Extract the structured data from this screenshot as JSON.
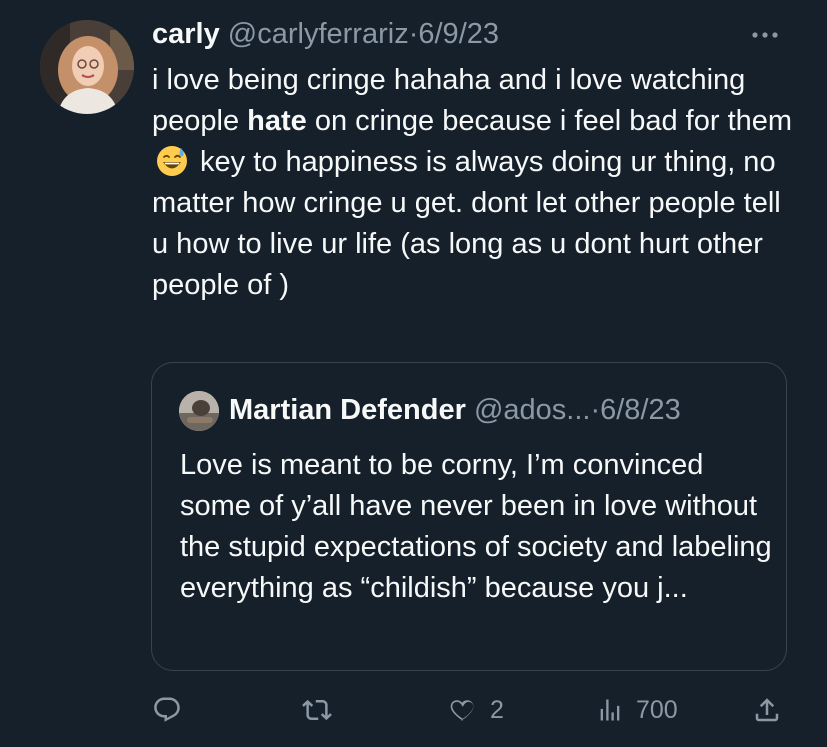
{
  "tweet": {
    "display_name": "carly",
    "handle": "@carlyferrariz",
    "separator": "·",
    "date": "6/9/23",
    "more_icon": "more-horizontal-icon",
    "body_part1": "i love being cringe hahaha and i love watching people ",
    "body_bold": "hate",
    "body_part2": " on cringe because i feel bad for them ",
    "emoji": "grinning-face-with-sweat-emoji",
    "body_part3": " key to happiness is always doing ur thing, no matter how cringe u get. dont let other people tell u how to live ur life (as long as u dont hurt other people of )"
  },
  "quote": {
    "display_name": "Martian Defender",
    "handle": "@ados...",
    "separator": "·",
    "date": "6/8/23",
    "text": "Love is meant to be corny, I’m convinced some of y’all have never been in love without the stupid expectations of society and labeling everything as “childish” because you j..."
  },
  "actions": {
    "reply": {
      "icon": "reply-icon",
      "count": ""
    },
    "retweet": {
      "icon": "retweet-icon",
      "count": ""
    },
    "like": {
      "icon": "heart-icon",
      "count": "2"
    },
    "views": {
      "icon": "views-icon",
      "count": "700"
    },
    "share": {
      "icon": "share-icon",
      "count": ""
    }
  },
  "colors": {
    "background": "#15202b",
    "text": "#f7f9f9",
    "secondary": "#8b98a5",
    "border": "#38444d"
  }
}
